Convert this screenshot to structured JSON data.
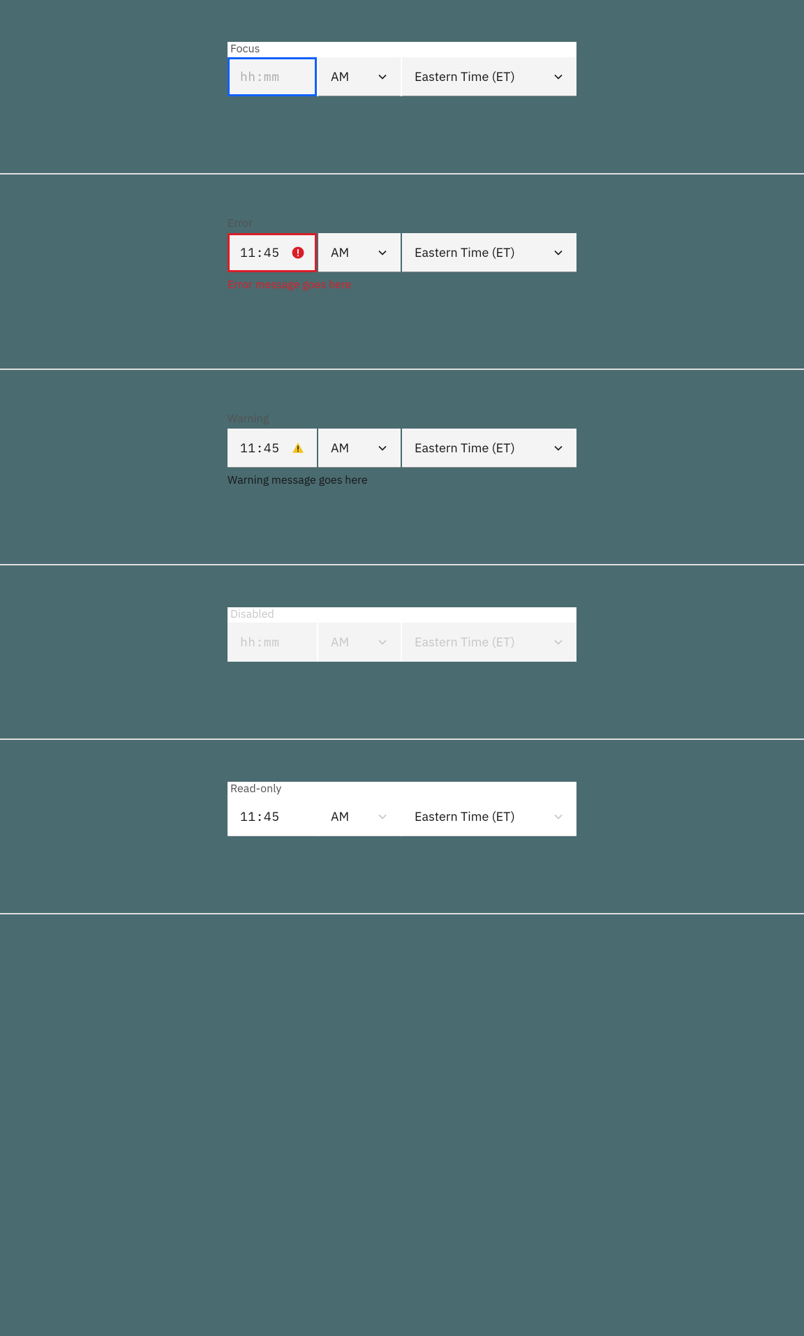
{
  "states": {
    "focus": {
      "label": "Focus",
      "time_placeholder": "hh:mm",
      "ampm": "AM",
      "timezone": "Eastern Time (ET)"
    },
    "error": {
      "label": "Error",
      "time_value": "11:45",
      "ampm": "AM",
      "timezone": "Eastern Time (ET)",
      "message": "Error message goes here"
    },
    "warning": {
      "label": "Warning",
      "time_value": "11:45",
      "ampm": "AM",
      "timezone": "Eastern Time (ET)",
      "message": "Warning message goes here"
    },
    "disabled": {
      "label": "Disabled",
      "time_placeholder": "hh:mm",
      "ampm": "AM",
      "timezone": "Eastern Time (ET)"
    },
    "readonly": {
      "label": "Read-only",
      "time_value": "11:45",
      "ampm": "AM",
      "timezone": "Eastern Time (ET)"
    }
  },
  "icons": {
    "chevron_down": "chevron-down-icon",
    "error_filled": "error-filled-icon",
    "warning_filled": "warning-filled-icon"
  },
  "colors": {
    "focus": "#0f62fe",
    "error": "#da1e28",
    "warning": "#f1c21b",
    "background": "#4a6b70",
    "field": "#f4f4f4"
  }
}
